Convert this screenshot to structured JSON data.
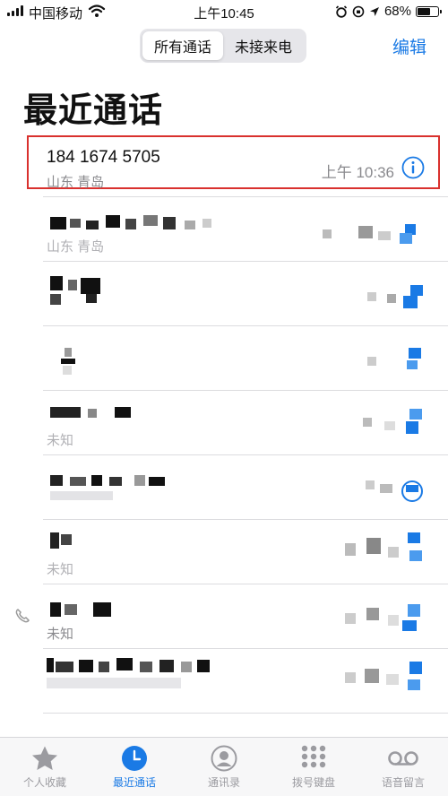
{
  "status_bar": {
    "carrier": "中国移动",
    "time": "上午10:45",
    "battery_text": "68%",
    "battery_level": 0.68
  },
  "header": {
    "segments": [
      {
        "label": "所有通话",
        "selected": true
      },
      {
        "label": "未接来电",
        "selected": false
      }
    ],
    "edit_label": "编辑",
    "title": "最近通话"
  },
  "calls": [
    {
      "number": "184 1674 5705",
      "location": "山东 青岛",
      "time": "上午 10:36",
      "highlighted": true
    },
    {
      "number": "",
      "location": "山东 青岛",
      "time": ""
    },
    {
      "number": "",
      "location": "",
      "time": ""
    },
    {
      "number": "",
      "location": "",
      "time": ""
    },
    {
      "number": "",
      "location": "未知",
      "time": ""
    },
    {
      "number": "",
      "location": "",
      "time": ""
    },
    {
      "number": "",
      "location": "未知",
      "time": ""
    },
    {
      "number": "",
      "location": "未知",
      "time": ""
    },
    {
      "number": "",
      "location": "",
      "time": ""
    }
  ],
  "tabs": [
    {
      "label": "个人收藏",
      "icon": "star-icon",
      "active": false
    },
    {
      "label": "最近通话",
      "icon": "clock-icon",
      "active": true
    },
    {
      "label": "通讯录",
      "icon": "contacts-icon",
      "active": false
    },
    {
      "label": "拨号键盘",
      "icon": "keypad-icon",
      "active": false
    },
    {
      "label": "语音留言",
      "icon": "voicemail-icon",
      "active": false
    }
  ],
  "colors": {
    "accent": "#1a7ae5",
    "highlight_border": "#d9312e",
    "secondary_text": "#8a8a8e"
  }
}
